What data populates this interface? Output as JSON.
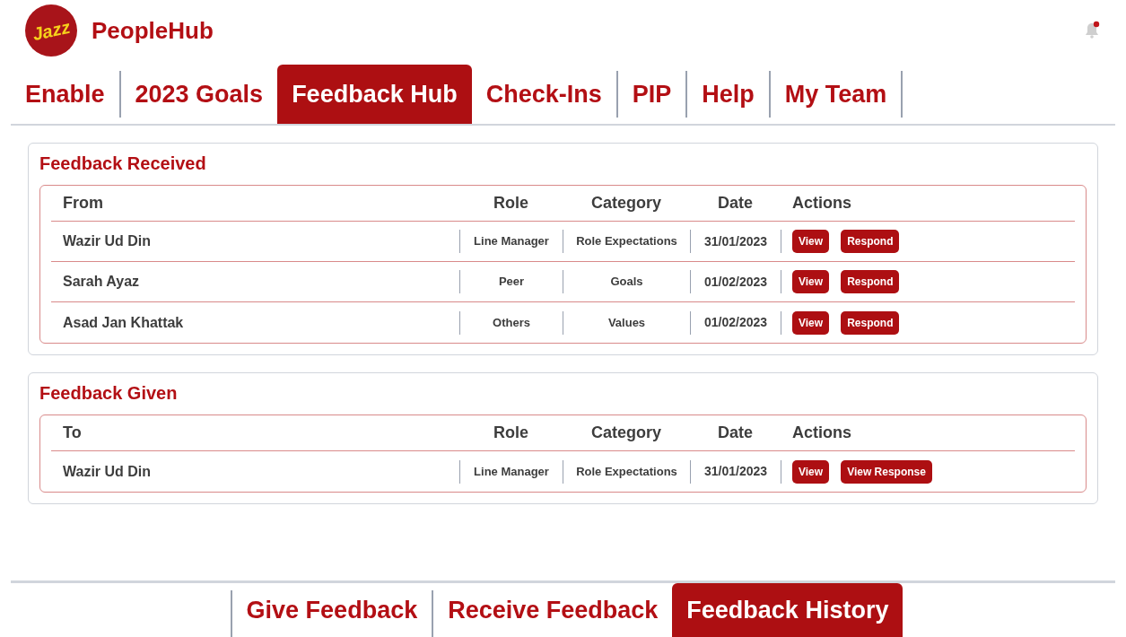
{
  "header": {
    "logo_text": "Jazz",
    "app_name": "PeopleHub",
    "notification_unread": true
  },
  "tabs": [
    {
      "label": "Enable",
      "selected": false
    },
    {
      "label": "2023 Goals",
      "selected": false
    },
    {
      "label": "Feedback Hub",
      "selected": true
    },
    {
      "label": "Check-Ins",
      "selected": false
    },
    {
      "label": "PIP",
      "selected": false
    },
    {
      "label": "Help",
      "selected": false
    },
    {
      "label": "My Team",
      "selected": false
    }
  ],
  "sections": [
    {
      "title": "Feedback Received",
      "columns": [
        "From",
        "Role",
        "Category",
        "Date",
        "Actions"
      ],
      "rows": [
        {
          "person": "Wazir Ud Din",
          "role": "Line Manager",
          "category": "Role Expectations",
          "date": "31/01/2023",
          "actions": [
            "View",
            "Respond"
          ]
        },
        {
          "person": "Sarah Ayaz",
          "role": "Peer",
          "category": "Goals",
          "date": "01/02/2023",
          "actions": [
            "View",
            "Respond"
          ]
        },
        {
          "person": "Asad Jan Khattak",
          "role": "Others",
          "category": "Values",
          "date": "01/02/2023",
          "actions": [
            "View",
            "Respond"
          ]
        }
      ]
    },
    {
      "title": "Feedback Given",
      "columns": [
        "To",
        "Role",
        "Category",
        "Date",
        "Actions"
      ],
      "rows": [
        {
          "person": "Wazir Ud Din",
          "role": "Line Manager",
          "category": "Role Expectations",
          "date": "31/01/2023",
          "actions": [
            "View",
            "View Response"
          ]
        }
      ]
    }
  ],
  "bottom_tabs": [
    {
      "label": "Give Feedback",
      "selected": false
    },
    {
      "label": "Receive Feedback",
      "selected": false
    },
    {
      "label": "Feedback History",
      "selected": true
    }
  ]
}
